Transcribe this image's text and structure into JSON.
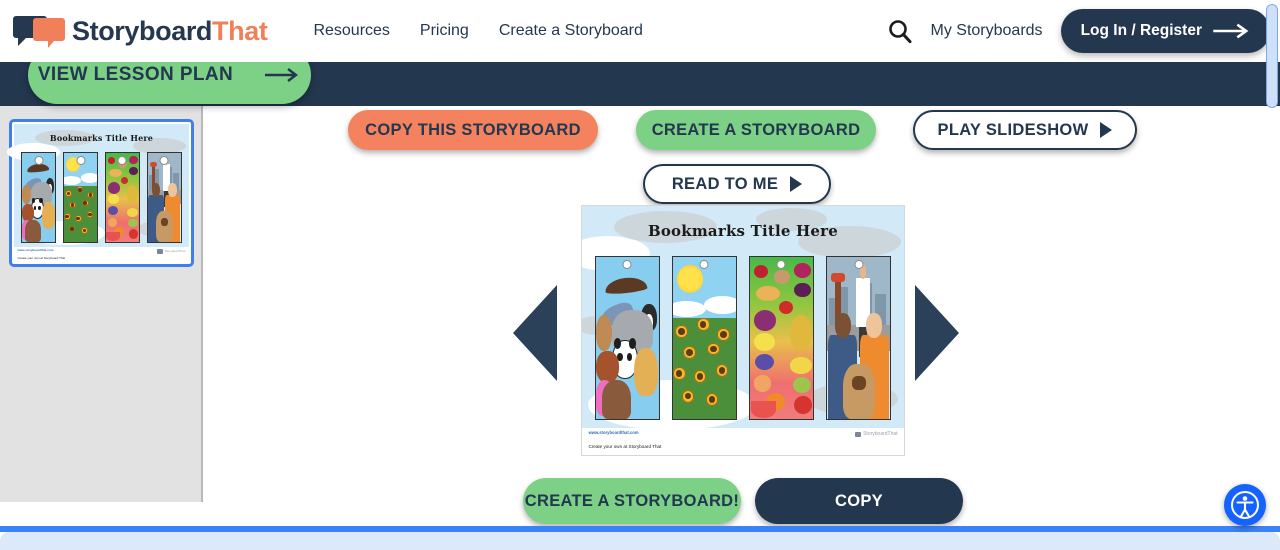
{
  "header": {
    "logo": {
      "icon": "speech-bubbles-icon",
      "text_part1": "Storyboard",
      "text_part2": "That"
    },
    "nav": [
      {
        "label": "Resources"
      },
      {
        "label": "Pricing"
      },
      {
        "label": "Create a Storyboard"
      }
    ],
    "search_icon": "search-icon",
    "my_storyboards_label": "My Storyboards",
    "login_label": "Log In / Register",
    "login_arrow_icon": "arrow-right-icon"
  },
  "band": {
    "lesson_plan_label": "VIEW LESSON PLAN",
    "lesson_plan_arrow_icon": "arrow-right-icon"
  },
  "sidebar": {
    "thumbnail": {
      "name": "storyboard-thumbnail",
      "selected": true,
      "title": "Bookmarks Title Here"
    }
  },
  "actions": {
    "copy_this_storyboard": "COPY THIS STORYBOARD",
    "create_a_storyboard": "CREATE A STORYBOARD",
    "play_slideshow": "PLAY SLIDESHOW",
    "read_to_me": "READ TO ME",
    "create_a_storyboard_bang": "CREATE A STORYBOARD!",
    "copy": "COPY"
  },
  "preview": {
    "title": "Bookmarks Title Here",
    "prev_arrow_icon": "chevron-left-icon",
    "next_arrow_icon": "chevron-right-icon",
    "footer_url": "www.storyboardthat.com",
    "footer_cta": "Create your own at Storyboard That",
    "footer_brand": "StoryboardThat",
    "panels": [
      {
        "name": "animals-bookmark",
        "subject": "animals"
      },
      {
        "name": "sunflowers-bookmark",
        "subject": "sunflowers"
      },
      {
        "name": "fruits-bookmark",
        "subject": "fruits"
      },
      {
        "name": "superheroes-bookmark",
        "subject": "superheroes"
      }
    ]
  },
  "accessibility": {
    "icon": "accessibility-icon",
    "label": "Accessibility"
  },
  "colors": {
    "navy": "#23374f",
    "orange": "#f4825f",
    "green": "#7dd186",
    "blue_accent": "#3b82f6",
    "sidebar_bg": "#e2e2e2"
  }
}
